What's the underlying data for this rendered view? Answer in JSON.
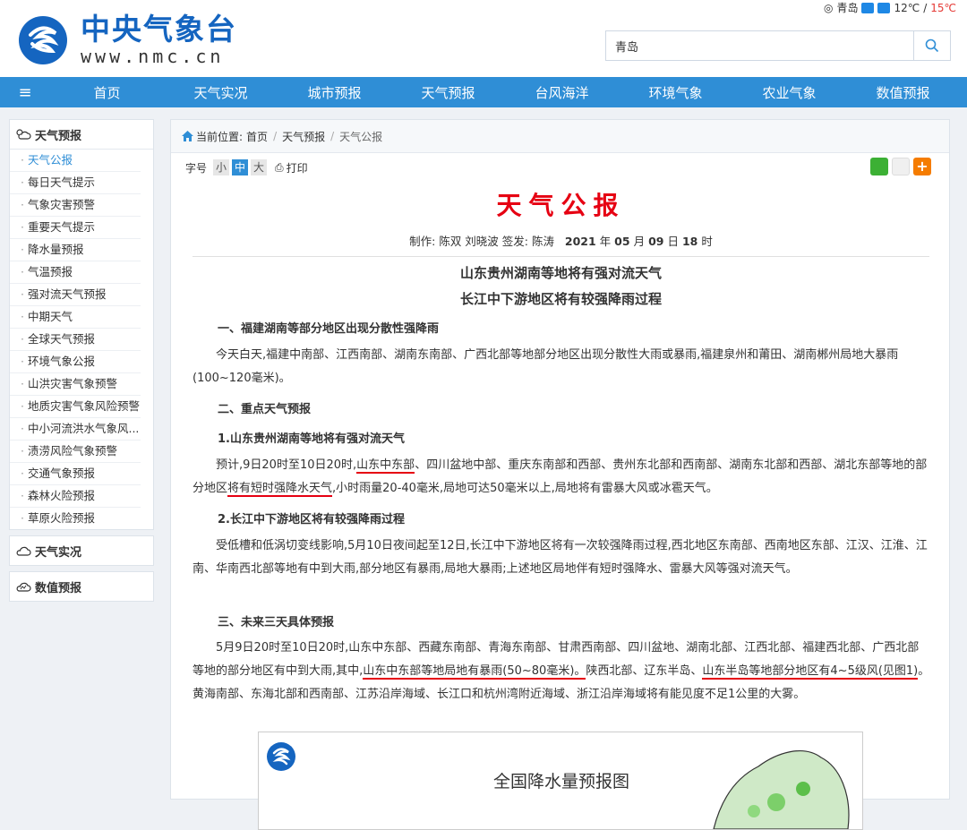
{
  "site": {
    "name_cn": "中央气象台",
    "url": "www.nmc.cn"
  },
  "weather_mini": {
    "city": "青岛",
    "low": "12℃",
    "sep": "/",
    "high": "15℃"
  },
  "search": {
    "value": "青岛"
  },
  "nav": {
    "items": [
      "首页",
      "天气实况",
      "城市预报",
      "天气预报",
      "台风海洋",
      "环境气象",
      "农业气象",
      "数值预报"
    ]
  },
  "sidebar": {
    "forecast_title": "天气预报",
    "items": [
      "天气公报",
      "每日天气提示",
      "气象灾害预警",
      "重要天气提示",
      "降水量预报",
      "气温预报",
      "强对流天气预报",
      "中期天气",
      "全球天气预报",
      "环境气象公报",
      "山洪灾害气象预警",
      "地质灾害气象风险预警",
      "中小河流洪水气象风...",
      "渍涝风险气象预警",
      "交通气象预报",
      "森林火险预报",
      "草原火险预报"
    ],
    "obs_title": "天气实况",
    "nwp_title": "数值预报"
  },
  "breadcrumb": {
    "label": "当前位置:",
    "items": [
      "首页",
      "天气预报",
      "天气公报"
    ]
  },
  "toolbar": {
    "font_label": "字号",
    "small": "小",
    "medium": "中",
    "large": "大",
    "print": "打印"
  },
  "bulletin": {
    "title": "天气公报",
    "meta": {
      "made_by": "制作: 陈双 刘晓波 签发: 陈涛",
      "year": "2021",
      "y": "年",
      "month": "05",
      "m": "月",
      "day": "09",
      "d": "日",
      "hour": "18",
      "h": "时"
    },
    "subtitle1": "山东贵州湖南等地将有强对流天气",
    "subtitle2": "长江中下游地区将有较强降雨过程",
    "s1": "一、福建湖南等部分地区出现分散性强降雨",
    "p1": "今天白天,福建中南部、江西南部、湖南东南部、广西北部等地部分地区出现分散性大雨或暴雨,福建泉州和莆田、湖南郴州局地大暴雨(100~120毫米)。",
    "s2": "二、重点天气预报",
    "s2_1": "1.山东贵州湖南等地将有强对流天气",
    "p2": {
      "a": "预计,9日20时至10日20时,",
      "b": "山东中东部",
      "c": "、四川盆地中部、重庆东南部和西部、贵州东北部和西南部、湖南东北部和西部、湖北东部等地的部分地区",
      "d": "将有短时强降水天气",
      "e": ",小时雨量20-40毫米,局地可达50毫米以上,局地将有雷暴大风或冰雹天气。"
    },
    "s2_2": "2.长江中下游地区将有较强降雨过程",
    "p3": "受低槽和低涡切变线影响,5月10日夜间起至12日,长江中下游地区将有一次较强降雨过程,西北地区东南部、西南地区东部、江汉、江淮、江南、华南西北部等地有中到大雨,部分地区有暴雨,局地大暴雨;上述地区局地伴有短时强降水、雷暴大风等强对流天气。",
    "s3": "三、未来三天具体预报",
    "p4": {
      "a": "5月9日20时至10日20时,山东中东部、西藏东南部、青海东南部、甘肃西南部、四川盆地、湖南北部、江西北部、福建西北部、广西北部等地的部分地区有中到大雨,其中,",
      "b": "山东中东部等地局地有暴雨(50~80毫米)。",
      "c": "陕西北部、辽东半岛、",
      "d": "山东半岛等地部分地区有4~5级风(见图1)",
      "e": "。黄海南部、东海北部和西南部、江苏沿岸海域、长江口和杭州湾附近海域、浙江沿岸海域将有能见度不足1公里的大雾。"
    },
    "figure_title": "全国降水量预报图"
  }
}
